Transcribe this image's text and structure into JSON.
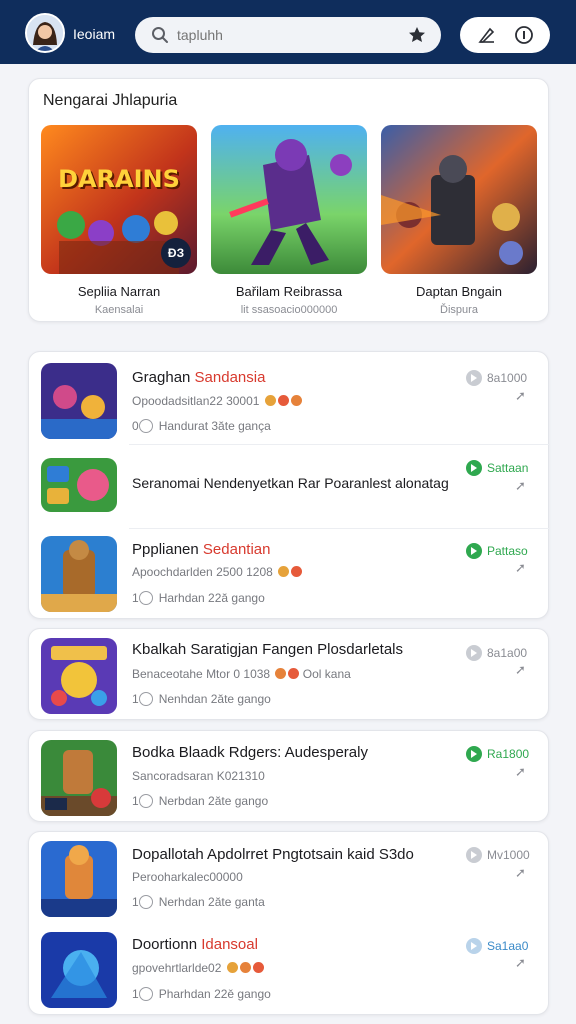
{
  "header": {
    "brand": "Ieoiam",
    "search_placeholder": "tapluhh",
    "icons": [
      "search-icon",
      "star-icon",
      "edit-icon",
      "info-icon"
    ]
  },
  "featured": {
    "title": "Nengarai Jhlapuria",
    "cards": [
      {
        "name": "Sepliia Narran",
        "sub": "Kaensalai",
        "art_text": "DARAINS",
        "badge": "ĐЗ"
      },
      {
        "name": "Bařilam Reibrassa",
        "sub": "lit ssasoacio000000"
      },
      {
        "name": "Daptan Bngain",
        "sub": "Ďispura"
      }
    ]
  },
  "list": [
    {
      "title": "Graghan",
      "title_hl": "Sandansia",
      "meta": "Opoodadsitlan22 30001",
      "downloads": "Handurat 3ăte gança",
      "count": "0",
      "price": "8a1000",
      "price_color": "#c9ccd2"
    },
    {
      "title": "Seranomai Nendenyetkan Rar Poaranlest alonatag",
      "title_hl": "",
      "meta": "",
      "downloads": "",
      "count": "",
      "price": "Sattaan",
      "price_color": "#2fa84f"
    },
    {
      "title": "Ppplianen",
      "title_hl": "Sedantian",
      "meta": "Apoochdarlden 2500 1208",
      "downloads": "Harhdan 22ă gango",
      "count": "1",
      "price": "Pattaso",
      "price_color": "#2fa84f"
    },
    {
      "title": "Kbalkah Saratigjan Fangen Plosdarletals",
      "title_hl": "",
      "meta": "Benaceotahe Mtor 0 1038",
      "meta2": "Ool kana",
      "downloads": "Nenhdan 2ăte gango",
      "count": "1",
      "price": "8a1a00",
      "price_color": "#c9ccd2"
    },
    {
      "title": "Bodka Blaadk Rdgers: Audesperaly",
      "title_hl": "",
      "meta": "Sancoradsaran K021310",
      "downloads": "Nerbdan 2ăte gango",
      "count": "1",
      "price": "Ra1800",
      "price_color": "#2fa84f"
    },
    {
      "title": "Dopallotah Apdolrret Pngtotsain kaid S3do",
      "title_hl": "",
      "meta": "Perooharkalec00000",
      "downloads": "Nerhdan 2ăte ganta",
      "count": "1",
      "price": "Mv1000",
      "price_color": "#c9ccd2"
    },
    {
      "title": "Doortionn",
      "title_hl": "Idansoal",
      "meta": "gpovehrtlarlde02",
      "downloads": "Pharhdan 22ě gango",
      "count": "1",
      "price": "Sa1aa0",
      "price_color": "#b9d3ea"
    }
  ]
}
